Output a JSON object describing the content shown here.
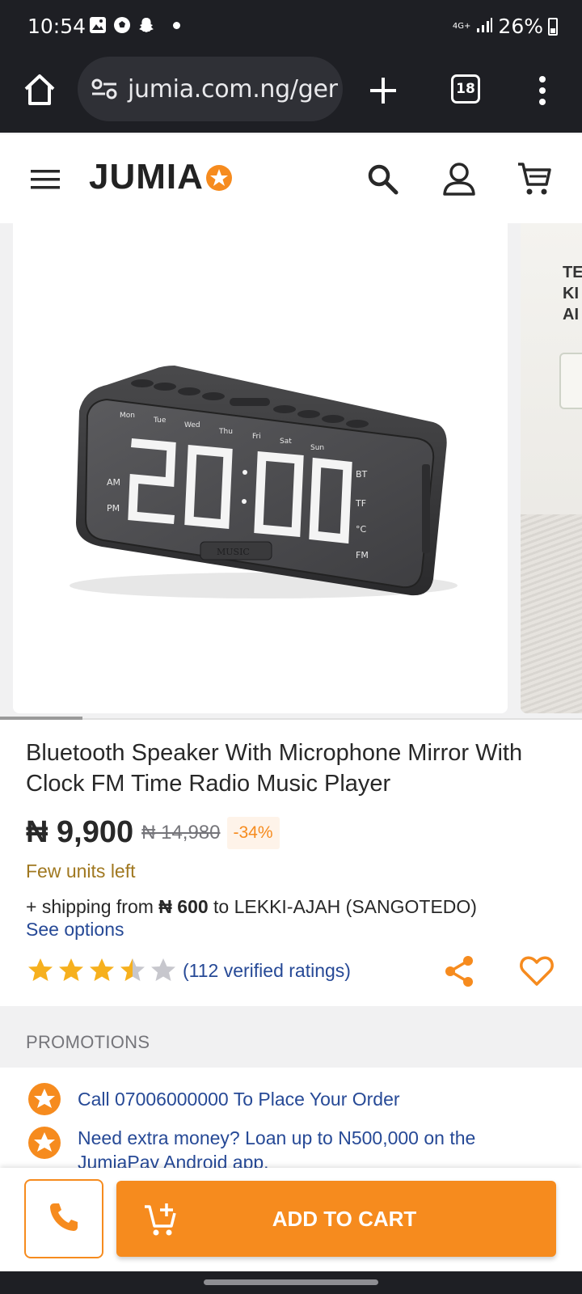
{
  "status_bar": {
    "time": "10:54",
    "network": "4G+",
    "battery": "26%"
  },
  "browser": {
    "url": "jumia.com.ng/ger",
    "tab_count": "18"
  },
  "header": {
    "logo": "JUMIA"
  },
  "gallery": {
    "next_image_text": "TE\nKI\nAI",
    "clock_display": "20:00",
    "clock_days": [
      "Mon",
      "Tue",
      "Wed",
      "Thu",
      "Fri",
      "Sat",
      "Sun"
    ],
    "clock_right_labels": [
      "BT",
      "TF",
      "°C",
      "FM"
    ],
    "clock_left_labels": [
      "AM",
      "PM"
    ],
    "clock_tab": "MUSIC"
  },
  "product": {
    "title": "Bluetooth Speaker With Microphone Mirror With Clock FM Time Radio Music Player",
    "price": "₦ 9,900",
    "old_price": "₦ 14,980",
    "discount": "-34%",
    "stock": "Few units left",
    "shipping_prefix": "+ shipping from",
    "shipping_amount": "₦ 600",
    "shipping_suffix": "to LEKKI-AJAH (SANGOTEDO)",
    "see_options": "See options",
    "rating_value": 3.5,
    "rating_text": "(112 verified ratings)"
  },
  "promotions": {
    "heading": "PROMOTIONS",
    "items": [
      "Call 07006000000 To Place Your Order",
      "Need extra money? Loan up to N500,000 on the JumiaPay Android app."
    ]
  },
  "actions": {
    "add_to_cart": "ADD TO CART"
  },
  "colors": {
    "brand_orange": "#f68b1e",
    "link_blue": "#264996",
    "dark_bar": "#1e1f24"
  }
}
